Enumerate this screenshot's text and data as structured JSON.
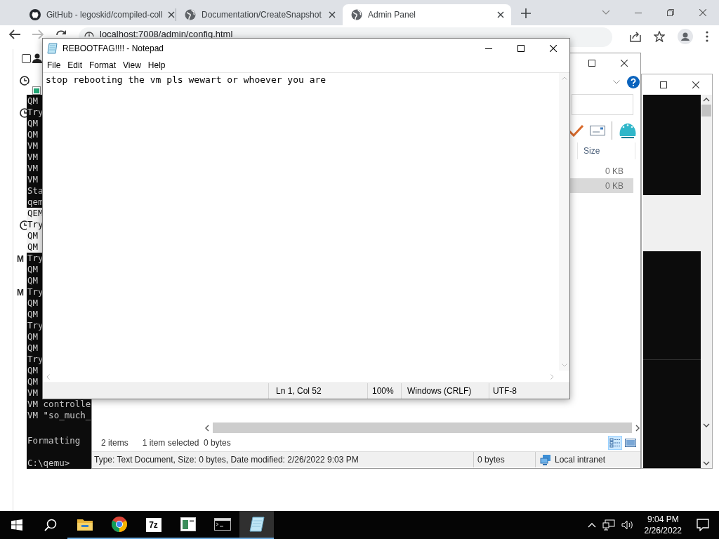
{
  "browser": {
    "tabs": [
      {
        "title": "GitHub - legoskid/compiled-coll",
        "kind": "github",
        "selected": false
      },
      {
        "title": "Documentation/CreateSnapshot",
        "kind": "web",
        "selected": false
      },
      {
        "title": "Admin Panel",
        "kind": "web",
        "selected": true
      }
    ],
    "url": "localhost:7008/admin/config.html"
  },
  "page": {
    "checkbox": {
      "checked": false
    },
    "letters": [
      "M",
      "M"
    ]
  },
  "console": {
    "lines": [
      {
        "text": "QM",
        "highlighted": false
      },
      {
        "text": "Try",
        "highlighted": false
      },
      {
        "text": "QM",
        "highlighted": false
      },
      {
        "text": "QM",
        "highlighted": false
      },
      {
        "text": "VM",
        "highlighted": false
      },
      {
        "text": "VM",
        "highlighted": false
      },
      {
        "text": "VM",
        "highlighted": false
      },
      {
        "text": "VM",
        "highlighted": false
      },
      {
        "text": "Sta",
        "highlighted": false
      },
      {
        "text": "qem",
        "highlighted": false
      },
      {
        "text": "QEM",
        "highlighted": true
      },
      {
        "text": "Try",
        "highlighted": true
      },
      {
        "text": "QM",
        "highlighted": true
      },
      {
        "text": "QM",
        "highlighted": true
      },
      {
        "text": "Try",
        "highlighted": false
      },
      {
        "text": "QM",
        "highlighted": false
      },
      {
        "text": "QM",
        "highlighted": false
      },
      {
        "text": "Try",
        "highlighted": false
      },
      {
        "text": "QM",
        "highlighted": false
      },
      {
        "text": "QM",
        "highlighted": false
      },
      {
        "text": "Try",
        "highlighted": false
      },
      {
        "text": "QM",
        "highlighted": false
      },
      {
        "text": "QM",
        "highlighted": false
      },
      {
        "text": "Try",
        "highlighted": false
      },
      {
        "text": "QM",
        "highlighted": false
      },
      {
        "text": "QM",
        "highlighted": false
      },
      {
        "text": "VM",
        "highlighted": false
      },
      {
        "text": "VM controlle",
        "highlighted": false
      },
      {
        "text": "VM \"so_much_",
        "highlighted": false
      }
    ],
    "output": "Formatting",
    "prompt": "C:\\qemu>"
  },
  "explorer": {
    "column": "Size",
    "rows": [
      {
        "size": "0 KB",
        "selected": false
      },
      {
        "size": "0 KB",
        "selected": true
      }
    ],
    "item_count": "2 items",
    "selection": "1 item selected  0 bytes",
    "status_text": "Type: Text Document, Size: 0 bytes, Date modified: 2/26/2022 9:03 PM",
    "status_size": "0 bytes",
    "zone": "Local intranet"
  },
  "notepad": {
    "title": "REBOOTFAG!!!! - Notepad",
    "menu": [
      "File",
      "Edit",
      "Format",
      "View",
      "Help"
    ],
    "text": "stop rebooting the vm pls wewart or whoever you are",
    "status": [
      "Ln 1, Col 52",
      "100%",
      "Windows (CRLF)",
      "UTF-8"
    ]
  },
  "taskbar": {
    "apps": [
      {
        "kind": "folder",
        "running": true,
        "selected": false
      },
      {
        "kind": "chrome",
        "running": true,
        "selected": false
      },
      {
        "kind": "archiver",
        "label": "7z",
        "running": true,
        "selected": false
      },
      {
        "kind": "window",
        "running": true,
        "selected": false
      },
      {
        "kind": "terminal",
        "running": true,
        "selected": false
      },
      {
        "kind": "notepad",
        "running": true,
        "selected": true
      }
    ],
    "time": "9:04 PM",
    "date": "2/26/2022"
  }
}
